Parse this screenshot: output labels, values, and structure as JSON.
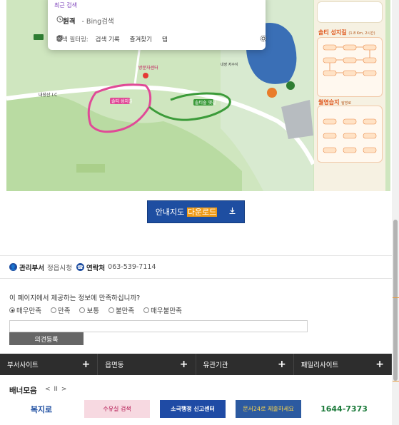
{
  "search_popup": {
    "recent_label": "최근 검색",
    "history": [
      {
        "query": "원격",
        "source": "- Bing검색"
      }
    ],
    "filter_label": "검색 필터링:",
    "filters": [
      "검색 기록",
      "즐겨찾기",
      "탭"
    ]
  },
  "map": {
    "labels": {
      "ic": "내장산 I.C",
      "entrance": "방문자센터",
      "trail1": "솔티 성지길",
      "trail2": "솔티숲 옛길",
      "kkk": "내장산 생태",
      "reservoir": "내장 저수지"
    },
    "info_panel": {
      "title1": "솔티 성지길",
      "title1_sub": "(1.8 Km, 2시간)",
      "title2": "월영습지",
      "title2_sub": "탐방로"
    }
  },
  "download": {
    "label_prefix": "안내지도",
    "label_highlight": "다운로드"
  },
  "department": {
    "manager_key": "관리부서",
    "manager_value": "정읍시청",
    "contact_key": "연락처",
    "contact_value": "063-539-7114"
  },
  "survey": {
    "question": "이 페이지에서 제공하는 정보에 만족하십니까?",
    "options": [
      "매우만족",
      "만족",
      "보통",
      "불만족",
      "매우불만족"
    ],
    "selected_index": 0,
    "opinion_placeholder": "",
    "submit_label": "의견등록"
  },
  "footer": {
    "columns": [
      "부서사이트",
      "읍면동",
      "유관기관",
      "패밀리사이트"
    ]
  },
  "banners": {
    "title": "배너모음",
    "controls": [
      "<",
      "II",
      ">"
    ],
    "items": [
      {
        "text": "복지로"
      },
      {
        "text": "수유실 검색"
      },
      {
        "text": "소극행정 신고센터"
      },
      {
        "text": "문서24로 제출하세요"
      },
      {
        "text": "1644-7373"
      }
    ]
  },
  "colors": {
    "accent": "#1e4ea1",
    "highlight": "#f09b17",
    "footer": "#2d2d2d"
  }
}
